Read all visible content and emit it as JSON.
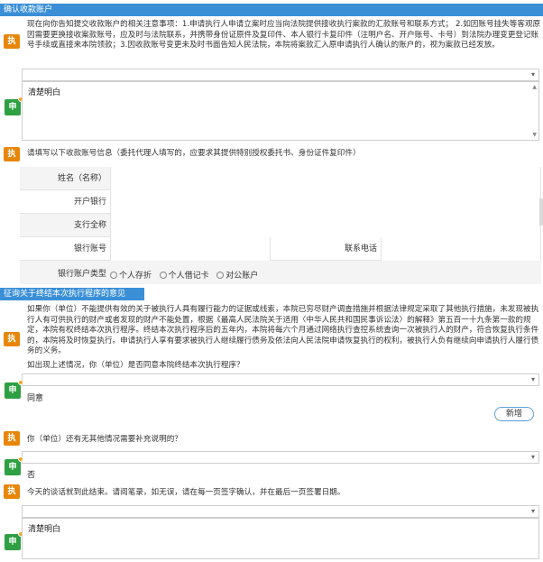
{
  "sections": {
    "account": {
      "header": "确认收款账户",
      "notice_badge": "执",
      "notice_text": "现在向你告知提交收款账户的相关注意事项：1.申请执行人申请立案时应当向法院提供接收执行案款的汇款账号和联系方式； 2.如因账号挂失等客观原因需要更换接收案款账号，应及时与法院联系，并携带身份证原件及复印件、本人银行卡复印件（注明户名、开户账号、卡号）到法院办理变更登记账号手续或直接来本院领款；3.因收款账号变更未及时书面告知人民法院，本院将案款汇入原申请执行人确认的账户的，视为案款已经发放。",
      "reply_badge": "申",
      "reply_text": "清楚明白"
    },
    "bank_info": {
      "badge": "执",
      "prompt": "请填写以下收款账号信息（委托代理人填写的，应要求其提供特别授权委托书、身份证件复印件）",
      "fields": {
        "name_label": "姓名（名称）",
        "bank_label": "开户银行",
        "branch_label": "支行全称",
        "account_label": "银行账号",
        "phone_label": "联系电话",
        "type_label": "银行账户类型"
      },
      "account_types": [
        "个人存折",
        "个人借记卡",
        "对公账户"
      ]
    },
    "termination": {
      "header": "征询关于终结本次执行程序的意见",
      "badge": "执",
      "text": "如果你（单位）不能提供有效的关于被执行人具有履行能力的证据或线索，本院已穷尽财产调查措施并根据法律规定采取了其他执行措施，未发现被执行人有可供执行的财产或者发现的财产不能处置，根据《最高人民法院关于适用〈中华人民共和国民事诉讼法〉的解释》第五百一十九条第一款的规定，本院有权终结本次执行程序。终结本次执行程序后的五年内，本院将每六个月通过网络执行查控系统查询一次被执行人的财产，符合恢复执行条件的，本院将及时恢复执行。申请执行人享有要求被执行人继续履行债务及依法向人民法院申请恢复执行的权利，被执行人负有继续向申请执行人履行债务的义务。",
      "question": "如出现上述情况，你（单位）是否同意本院终结本次执行程序？",
      "reply_badge": "申",
      "answer": "同意",
      "add_button": "新增"
    },
    "supplement": {
      "badge": "执",
      "question": "你（单位）还有无其他情况需要补充说明的？",
      "reply_badge": "申",
      "answer": "否"
    },
    "closing": {
      "badge": "执",
      "text": "今天的谈话就到此结束。请阅笔录，如无误，请在每一页签字确认，并在最后一页签署日期。",
      "reply_badge": "申",
      "reply_text": "清楚明白"
    }
  }
}
